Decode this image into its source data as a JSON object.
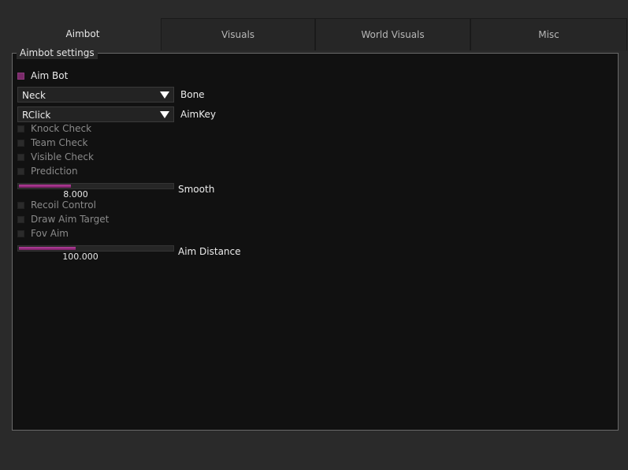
{
  "tabs": [
    {
      "label": "Aimbot",
      "active": true
    },
    {
      "label": "Visuals",
      "active": false
    },
    {
      "label": "World Visuals",
      "active": false
    },
    {
      "label": "Misc",
      "active": false
    }
  ],
  "panel": {
    "title": "Aimbot settings"
  },
  "aim_bot": {
    "label": "Aim Bot",
    "checked": true
  },
  "bone": {
    "selected": "Neck",
    "label": "Bone"
  },
  "aim_key": {
    "selected": "RClick",
    "label": "AimKey"
  },
  "checks": [
    {
      "label": "Knock Check",
      "checked": false
    },
    {
      "label": "Team Check",
      "checked": false
    },
    {
      "label": "Visible Check",
      "checked": false
    },
    {
      "label": "Prediction",
      "checked": false
    }
  ],
  "smooth": {
    "label": "Smooth",
    "value": "8.000",
    "fill_fraction": 0.34
  },
  "options2": [
    {
      "label": "Recoil Control",
      "checked": false
    },
    {
      "label": "Draw Aim Target",
      "checked": false
    },
    {
      "label": "Fov Aim",
      "checked": false
    }
  ],
  "aim_distance": {
    "label": "Aim Distance",
    "value": "100.000",
    "fill_fraction": 0.37
  },
  "colors": {
    "accent": "#9c2f86",
    "panel_bg": "#111111",
    "window_bg": "#2a2a2a"
  }
}
